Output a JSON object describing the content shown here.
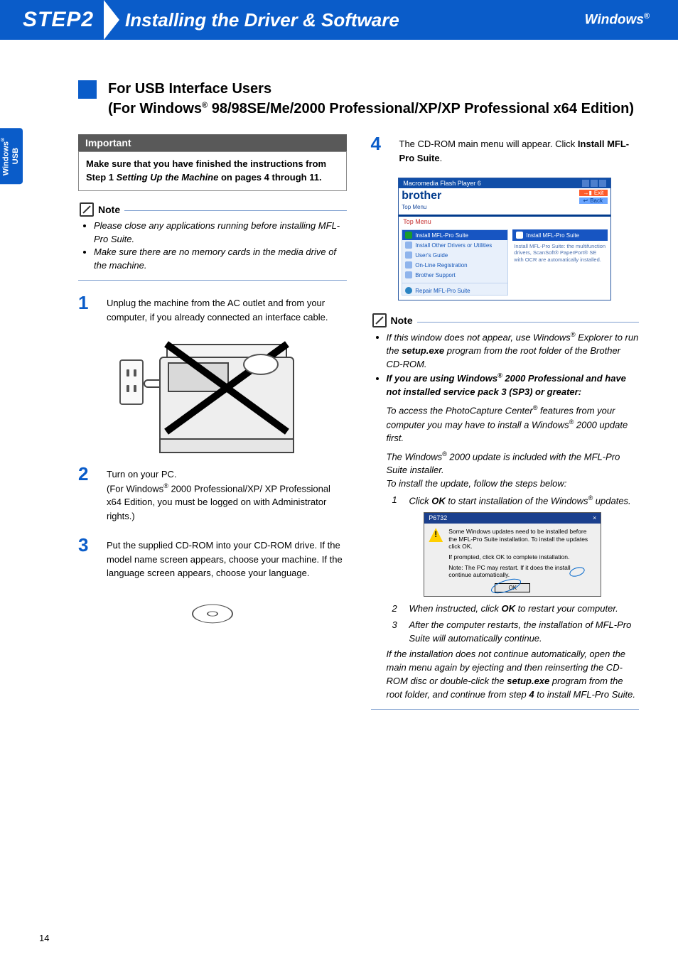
{
  "header": {
    "step": "STEP2",
    "title": "Installing the Driver & Software",
    "os": "Windows",
    "os_sup": "®"
  },
  "sidetab": {
    "line1": "Windows",
    "line1_sup": "®",
    "line2": "USB"
  },
  "section": {
    "title_line1": "For USB Interface Users",
    "title_line2_a": "(For Windows",
    "title_line2_sup": "®",
    "title_line2_b": " 98/98SE/Me/2000 Professional/XP/XP Professional x64 Edition)"
  },
  "important": {
    "label": "Important",
    "body_a": "Make sure that you have finished the instructions from Step 1 ",
    "body_b": "Setting Up the Machine",
    "body_c": " on pages 4 through 11."
  },
  "note1": {
    "label": "Note",
    "b1": "Please close any applications running before installing MFL-Pro Suite.",
    "b2": "Make sure there are no memory cards in the media drive of the machine."
  },
  "steps": {
    "s1": "Unplug the machine from the AC outlet and from your computer, if you already connected an interface cable.",
    "s2a": "Turn on your PC.",
    "s2b_a": "(For Windows",
    "s2b_sup": "®",
    "s2b_b": " 2000 Professional/XP/ XP Professional x64 Edition, you must be logged on with Administrator rights.)",
    "s3": "Put the supplied CD-ROM into your CD-ROM drive. If the model name screen appears, choose your machine. If the language screen appears, choose your language.",
    "s4a": "The CD-ROM main menu will appear. Click ",
    "s4b": "Install MFL-Pro Suite",
    "s4c": "."
  },
  "screenshot": {
    "wintitle": "Macromedia Flash Player 6",
    "brand": "brother",
    "exit": "Exit",
    "back": "Back",
    "topmenu_tab": "Top Menu",
    "topmenu": "Top Menu",
    "items": [
      "Install MFL-Pro Suite",
      "Install Other Drivers or Utilities",
      "User's Guide",
      "On-Line Registration",
      "Brother Support"
    ],
    "right_btn": "Install MFL-Pro Suite",
    "right_desc": "Install MFL-Pro Suite: the multifunction drivers, ScanSoft® PaperPort® SE with OCR are automatically installed.",
    "repair": "Repair MFL-Pro Suite"
  },
  "note2": {
    "label": "Note",
    "p1a": "If this window does not appear, use Windows",
    "p1sup": "®",
    "p1b": " Explorer to run the ",
    "p1c": "setup.exe",
    "p1d": " program from the root folder of the Brother CD-ROM.",
    "p2a": "If you are using Windows",
    "p2sup": "®",
    "p2b": " 2000 Professional and have not installed service pack 3 (SP3) or greater:",
    "p3a": "To access the PhotoCapture Center",
    "p3sup": "®",
    "p3b": " features from your computer you may have to install a Windows",
    "p3sup2": "®",
    "p3c": " 2000 update first.",
    "p4a": "The Windows",
    "p4sup": "®",
    "p4b": " 2000 update is included with the MFL-Pro Suite installer.",
    "p5": "To install the update, follow the steps below:",
    "sub1a": "Click ",
    "sub1b": "OK",
    "sub1c": " to start installation of the Windows",
    "sub1sup": "®",
    "sub1d": " updates.",
    "sub2a": "When instructed, click ",
    "sub2b": "OK",
    "sub2c": " to restart your computer.",
    "sub3": "After the computer restarts, the installation of MFL-Pro Suite will automatically continue.",
    "tail_a": "If the installation does not continue automatically, open the main menu again by ejecting and then reinserting the CD-ROM disc or double-click the ",
    "tail_b": "setup.exe",
    "tail_c": " program from the root folder, and continue from step ",
    "tail_d": "4",
    "tail_e": " to install MFL-Pro Suite."
  },
  "dialog": {
    "title": "P6732",
    "line1": "Some Windows updates need to be installed before the MFL-Pro Suite installation. To install the updates click OK.",
    "line2": "If prompted, click OK to complete installation.",
    "line3a": "Note: The PC may restart. If it does the install",
    "line3b": "continue automatically.",
    "ok": "OK"
  },
  "substeps": {
    "n1": "1",
    "n2": "2",
    "n3": "3"
  },
  "stepnums": {
    "n1": "1",
    "n2": "2",
    "n3": "3",
    "n4": "4"
  },
  "page": "14"
}
